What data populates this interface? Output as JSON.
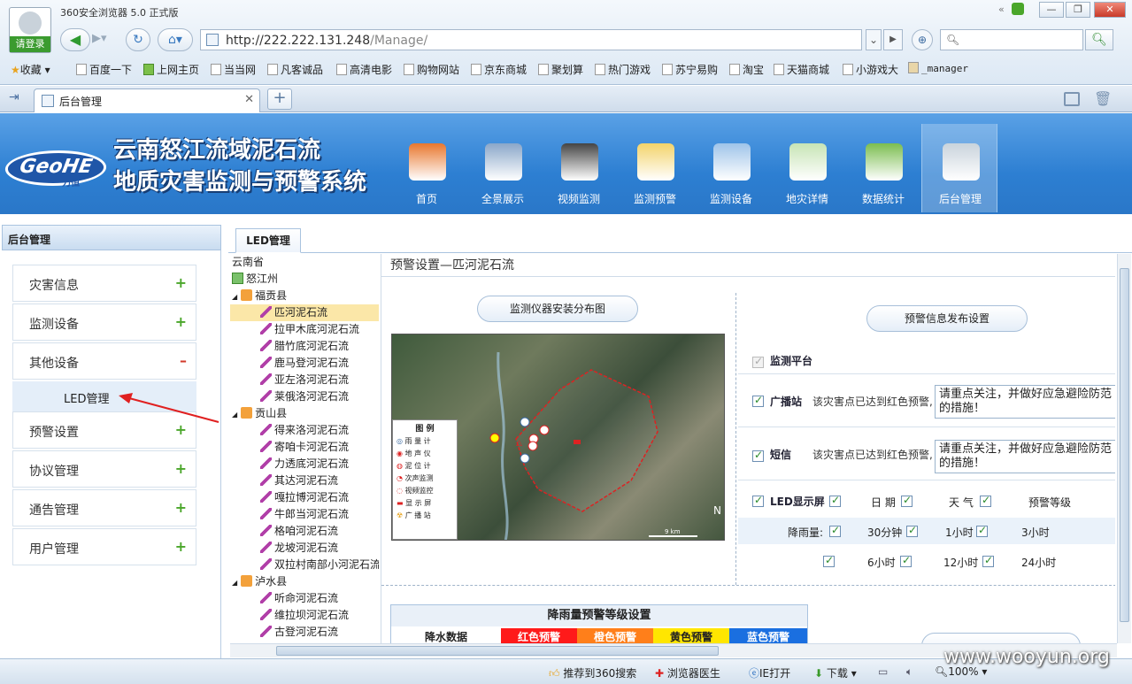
{
  "browser": {
    "title": "360安全浏览器 5.0 正式版",
    "login": "请登录",
    "url_host": "http://222.222.131.248",
    "url_path": "/Manage/",
    "search_placeholder": "",
    "tab_title": "后台管理",
    "favorites": [
      "收藏",
      "百度一下",
      "上网主页",
      "当当网",
      "凡客诚品",
      "高清电影",
      "购物网站",
      "京东商城",
      "聚划算",
      "热门游戏",
      "苏宁易购",
      "淘宝",
      "天猫商城",
      "小游戏大",
      "_manager"
    ]
  },
  "site": {
    "logo": "GeoHE",
    "logo_sub": "力恒",
    "title_line1": "云南怒江流域泥石流",
    "title_line2": "地质灾害监测与预警系统",
    "nav": [
      {
        "label": "首页",
        "icon": "home-icon",
        "color": "#e8772e"
      },
      {
        "label": "全景展示",
        "icon": "panorama-icon",
        "color": "#8aa7c9"
      },
      {
        "label": "视频监测",
        "icon": "webcam-icon",
        "color": "#444"
      },
      {
        "label": "监测预警",
        "icon": "chart-alert-icon",
        "color": "#f3d36a"
      },
      {
        "label": "监测设备",
        "icon": "satellite-icon",
        "color": "#9fc4e9"
      },
      {
        "label": "地灾详情",
        "icon": "document-icon",
        "color": "#c7e4b5"
      },
      {
        "label": "数据统计",
        "icon": "statistics-icon",
        "color": "#7bbd4f"
      },
      {
        "label": "后台管理",
        "icon": "database-gear-icon",
        "color": "#c9d3dc"
      }
    ]
  },
  "sidebar": {
    "title": "后台管理",
    "items": [
      {
        "label": "灾害信息",
        "sign": "+"
      },
      {
        "label": "监测设备",
        "sign": "+"
      },
      {
        "label": "其他设备",
        "sign": "–"
      },
      {
        "label": "预警设置",
        "sign": "+"
      },
      {
        "label": "协议管理",
        "sign": "+"
      },
      {
        "label": "通告管理",
        "sign": "+"
      },
      {
        "label": "用户管理",
        "sign": "+"
      }
    ],
    "subitem": "LED管理"
  },
  "main": {
    "tab": "LED管理",
    "content_title": "预警设置—匹河泥石流"
  },
  "tree": [
    {
      "label": "云南省",
      "level": 0,
      "icon": ""
    },
    {
      "label": "怒江州",
      "level": 0,
      "icon": "city"
    },
    {
      "label": "福贡县",
      "level": 1,
      "icon": "county",
      "toggle": "◢"
    },
    {
      "label": "匹河泥石流",
      "level": 2,
      "icon": "flow",
      "selected": true
    },
    {
      "label": "拉甲木底河泥石流",
      "level": 2,
      "icon": "flow"
    },
    {
      "label": "腊竹底河泥石流",
      "level": 2,
      "icon": "flow"
    },
    {
      "label": "鹿马登河泥石流",
      "level": 2,
      "icon": "flow"
    },
    {
      "label": "亚左洛河泥石流",
      "level": 2,
      "icon": "flow"
    },
    {
      "label": "莱俄洛河泥石流",
      "level": 2,
      "icon": "flow"
    },
    {
      "label": "贡山县",
      "level": 1,
      "icon": "county",
      "toggle": "◢"
    },
    {
      "label": "得来洛河泥石流",
      "level": 2,
      "icon": "flow"
    },
    {
      "label": "寄咱卡河泥石流",
      "level": 2,
      "icon": "flow"
    },
    {
      "label": "力透底河泥石流",
      "level": 2,
      "icon": "flow"
    },
    {
      "label": "其达河泥石流",
      "level": 2,
      "icon": "flow"
    },
    {
      "label": "嘎拉博河泥石流",
      "level": 2,
      "icon": "flow"
    },
    {
      "label": "牛郎当河泥石流",
      "level": 2,
      "icon": "flow"
    },
    {
      "label": "格咱河泥石流",
      "level": 2,
      "icon": "flow"
    },
    {
      "label": "龙坡河泥石流",
      "level": 2,
      "icon": "flow"
    },
    {
      "label": "双拉村南部小河泥石流",
      "level": 2,
      "icon": "flow"
    },
    {
      "label": "泸水县",
      "level": 1,
      "icon": "county",
      "toggle": "◢"
    },
    {
      "label": "听命河泥石流",
      "level": 2,
      "icon": "flow"
    },
    {
      "label": "维拉坝河泥石流",
      "level": 2,
      "icon": "flow"
    },
    {
      "label": "古登河泥石流",
      "level": 2,
      "icon": "flow"
    }
  ],
  "left_panel": {
    "map_button": "监测仪器安装分布图",
    "legend_title": "图 例",
    "legend": [
      "雨 量 计",
      "地 声 仪",
      "泥 位 计",
      "次声监测",
      "视频监控",
      "显 示 屏",
      "广 播 站"
    ],
    "map_scale": "9 km",
    "north": "N"
  },
  "right_panel": {
    "publish_button": "预警信息发布设置",
    "platform": "监测平台",
    "broadcast_label": "广播站",
    "sms_label": "短信",
    "notice": "该灾害点已达到红色预警,",
    "message": "请重点关注，并做好应急避险防范的措施！",
    "led_label": "LED显示屏",
    "date": "日 期",
    "weather": "天 气",
    "level": "预警等级",
    "rainfall": "降雨量:",
    "h30m": "30分钟",
    "h1": "1小时",
    "h3": "3小时",
    "h6": "6小时",
    "h12": "12小时",
    "h24": "24小时"
  },
  "rain_table": {
    "title": "降雨量预警等级设置",
    "cols": [
      {
        "label": "降水数据",
        "bg": "#ffffff",
        "fg": "#222"
      },
      {
        "label": "红色预警",
        "bg": "#ff1a1a",
        "fg": "#fff"
      },
      {
        "label": "橙色预警",
        "bg": "#ff7f1a",
        "fg": "#fff"
      },
      {
        "label": "黄色预警",
        "bg": "#ffe600",
        "fg": "#222"
      },
      {
        "label": "蓝色预警",
        "bg": "#1a6fe0",
        "fg": "#fff"
      }
    ]
  },
  "status": {
    "push": "推荐到360搜索",
    "doctor": "浏览器医生",
    "ie": "IE打开",
    "download": "下载",
    "zoom": "100%"
  },
  "watermark": "www.wooyun.org"
}
